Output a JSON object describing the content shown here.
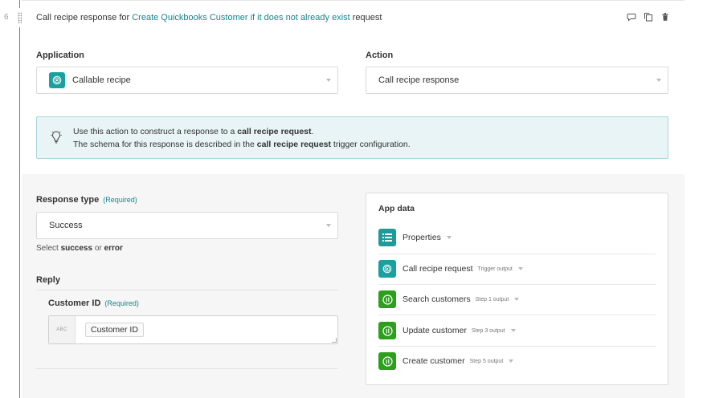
{
  "step": {
    "number": "6",
    "title_prefix": "Call recipe response for ",
    "title_link": "Create Quickbooks Customer if it does not already exist",
    "title_suffix": " request"
  },
  "application": {
    "label": "Application",
    "value": "Callable recipe"
  },
  "action": {
    "label": "Action",
    "value": "Call recipe response"
  },
  "info": {
    "line1_prefix": "Use this action to construct a response to a ",
    "line1_bold": "call recipe request",
    "line1_suffix": ".",
    "line2_prefix": "The schema for this response is described in the ",
    "line2_bold": "call recipe request",
    "line2_suffix": " trigger configuration."
  },
  "response_type": {
    "label": "Response type",
    "required": "(Required)",
    "value": "Success",
    "hint_prefix": "Select ",
    "hint_bold1": "success",
    "hint_mid": " or ",
    "hint_bold2": "error"
  },
  "reply": {
    "label": "Reply",
    "customer_id": {
      "label": "Customer ID",
      "required": "(Required)",
      "type_badge": "ABC",
      "pill": "Customer ID"
    }
  },
  "app_data": {
    "title": "App data",
    "items": [
      {
        "label": "Properties",
        "sub": "",
        "icon": "list-icon",
        "color": "#1f9a9a"
      },
      {
        "label": "Call recipe request",
        "sub": "Trigger output",
        "icon": "callable-recipe-icon",
        "color": "#1aa0a0"
      },
      {
        "label": "Search customers",
        "sub": "Step 1 output",
        "icon": "quickbooks-icon",
        "color": "#2ca01c"
      },
      {
        "label": "Update customer",
        "sub": "Step 3 output",
        "icon": "quickbooks-icon",
        "color": "#2ca01c"
      },
      {
        "label": "Create customer",
        "sub": "Step 5 output",
        "icon": "quickbooks-icon",
        "color": "#2ca01c"
      }
    ]
  },
  "colors": {
    "accent": "#14868c",
    "quickbooks": "#2ca01c",
    "info_bg": "#e8f4f5"
  }
}
